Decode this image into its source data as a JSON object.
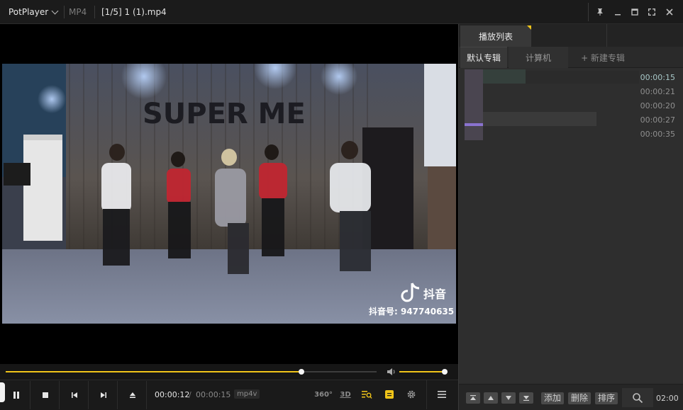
{
  "titlebar": {
    "app_name": "PotPlayer",
    "format": "MP4",
    "file_title": "[1/5] 1 (1).mp4"
  },
  "video": {
    "wall_text": "SUPER ME",
    "watermark_app": "抖音",
    "watermark_id": "抖音号: 947740635"
  },
  "controls": {
    "time_current": "00:00:12",
    "time_separator": "/",
    "time_total": "00:00:15",
    "codec": "mp4v",
    "btn_360": "360°",
    "btn_3d": "3D",
    "seek_progress": 0.8,
    "volume": 1.0
  },
  "playlist": {
    "tab_label": "播放列表",
    "albums": [
      "默认专辑",
      "计算机",
      "+ 新建专辑"
    ],
    "items": [
      {
        "duration": "00:00:15",
        "current": true
      },
      {
        "duration": "00:00:21",
        "current": false
      },
      {
        "duration": "00:00:20",
        "current": false
      },
      {
        "duration": "00:00:27",
        "current": false
      },
      {
        "duration": "00:00:35",
        "current": false
      }
    ],
    "toolbar": {
      "add": "添加",
      "delete": "删除",
      "sort": "排序",
      "total_time": "02:00"
    }
  },
  "colors": {
    "accent": "#f0c419",
    "panel": "#2e2e2e",
    "titlebar": "#1b1b1b"
  }
}
